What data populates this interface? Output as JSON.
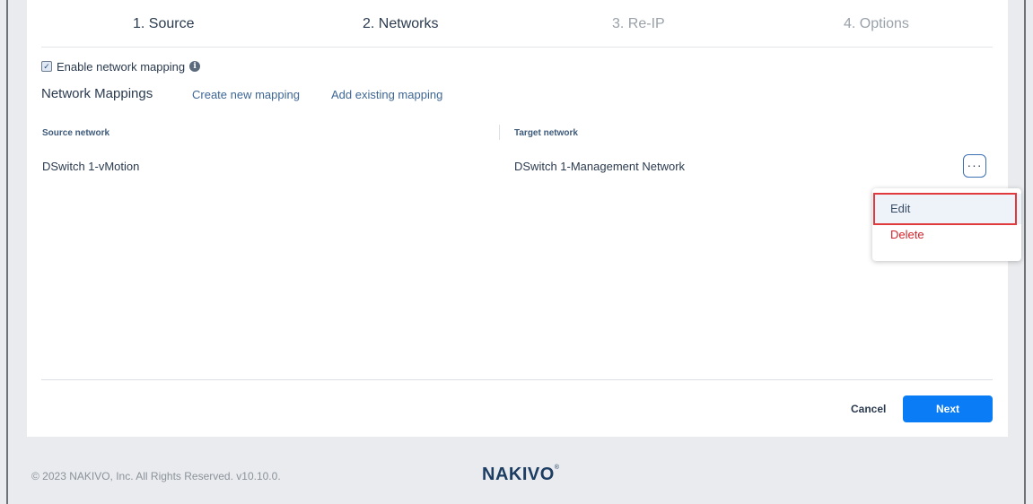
{
  "steps": [
    {
      "label": "1. Source"
    },
    {
      "label": "2. Networks"
    },
    {
      "label": "3. Re-IP"
    },
    {
      "label": "4. Options"
    }
  ],
  "enable_mapping": {
    "label": "Enable network mapping",
    "checked": true,
    "check_glyph": "✓",
    "info_glyph": "i"
  },
  "mappings": {
    "title": "Network Mappings",
    "create_link": "Create new mapping",
    "add_link": "Add existing mapping"
  },
  "table": {
    "source_header": "Source network",
    "target_header": "Target network",
    "rows": [
      {
        "source": "DSwitch 1-vMotion",
        "target": "DSwitch 1-Management Network"
      }
    ]
  },
  "row_menu": {
    "more_glyph": "···",
    "edit": "Edit",
    "delete": "Delete"
  },
  "footer": {
    "cancel": "Cancel",
    "next": "Next",
    "copyright": "© 2023 NAKIVO, Inc. All Rights Reserved. v10.10.0.",
    "logo": "NAKIVO",
    "logo_mark": "®"
  },
  "colors": {
    "accent": "#0a7cf5",
    "delete": "#d3242b",
    "highlight": "#e03a3e"
  }
}
